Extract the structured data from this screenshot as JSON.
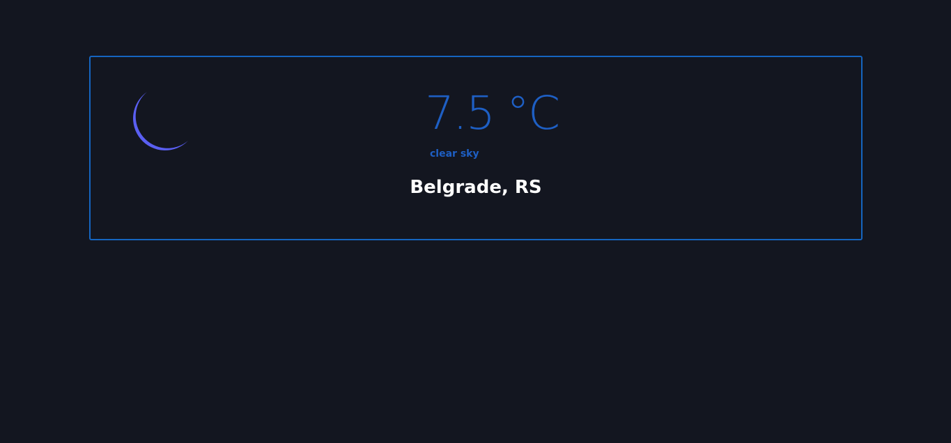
{
  "weather": {
    "icon": "moon-icon",
    "temperature": "7.5",
    "unit": "°C",
    "description": "clear sky",
    "location": "Belgrade, RS"
  },
  "colors": {
    "background": "#131620",
    "accent": "#1565c0",
    "temperature_text": "#1e5fc4",
    "moon": "#5a5ff2",
    "location_text": "#ffffff"
  }
}
